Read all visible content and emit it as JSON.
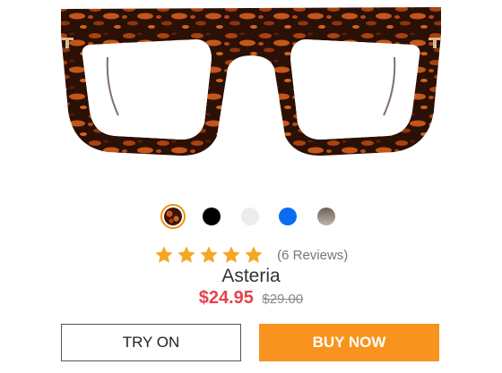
{
  "product": {
    "name": "Asteria",
    "sale_price": "$24.95",
    "original_price": "$29.00"
  },
  "swatches": [
    {
      "name": "tortoise",
      "color": "#7a3a10",
      "selected": true
    },
    {
      "name": "black",
      "color": "#000000",
      "selected": false
    },
    {
      "name": "clear",
      "color": "#ececec",
      "selected": false
    },
    {
      "name": "blue",
      "color": "#0b6cf2",
      "selected": false
    },
    {
      "name": "gradient-brown",
      "color": "#9c8f84",
      "selected": false
    }
  ],
  "rating": {
    "stars": 5,
    "max_stars": 5,
    "reviews_text": "(6 Reviews)"
  },
  "actions": {
    "try_on_label": "TRY ON",
    "buy_now_label": "BUY NOW"
  },
  "colors": {
    "accent": "#f7931e",
    "sale": "#e8424d",
    "star": "#f5a623"
  }
}
